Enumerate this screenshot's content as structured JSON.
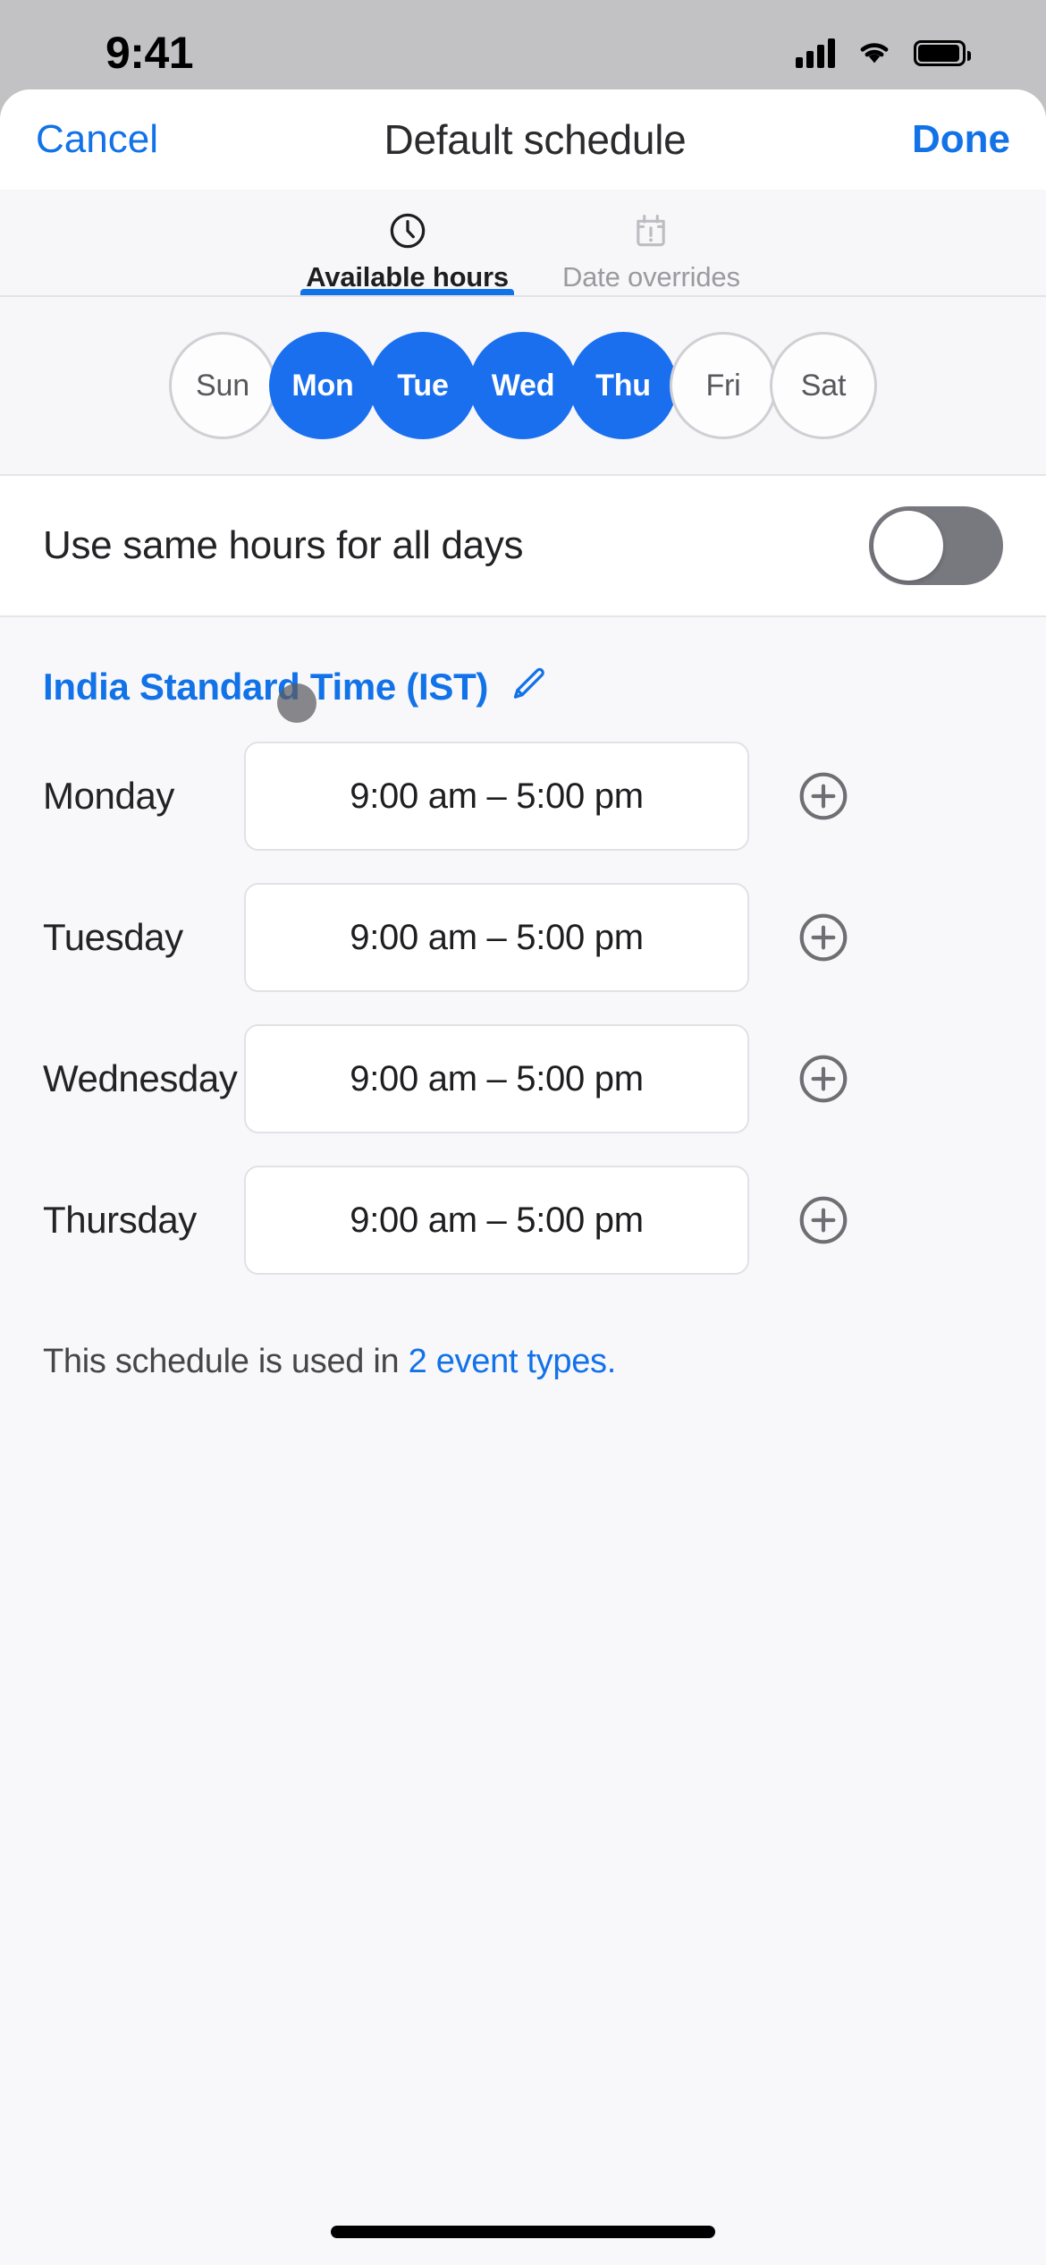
{
  "status_bar": {
    "time": "9:41",
    "cellular_icon": "signal-bars-icon",
    "wifi_icon": "wifi-icon",
    "battery_icon": "battery-full-icon"
  },
  "nav": {
    "cancel_label": "Cancel",
    "title": "Default schedule",
    "done_label": "Done"
  },
  "tabs": [
    {
      "label": "Available hours",
      "icon": "clock-icon",
      "active": true
    },
    {
      "label": "Date overrides",
      "icon": "calendar-alert-icon",
      "active": false
    }
  ],
  "day_selector": {
    "days": [
      {
        "label": "Sun",
        "selected": false
      },
      {
        "label": "Mon",
        "selected": true
      },
      {
        "label": "Tue",
        "selected": true
      },
      {
        "label": "Wed",
        "selected": true
      },
      {
        "label": "Thu",
        "selected": true
      },
      {
        "label": "Fri",
        "selected": false
      },
      {
        "label": "Sat",
        "selected": false
      }
    ]
  },
  "same_hours": {
    "label": "Use same hours for all days",
    "enabled": false
  },
  "timezone": {
    "label": "India Standard Time (IST)",
    "edit_icon": "pencil-icon"
  },
  "schedule_rows": [
    {
      "day": "Monday",
      "time_range": "9:00 am – 5:00 pm",
      "add_icon": "plus-circle-icon"
    },
    {
      "day": "Tuesday",
      "time_range": "9:00 am – 5:00 pm",
      "add_icon": "plus-circle-icon"
    },
    {
      "day": "Wednesday",
      "time_range": "9:00 am – 5:00 pm",
      "add_icon": "plus-circle-icon"
    },
    {
      "day": "Thursday",
      "time_range": "9:00 am – 5:00 pm",
      "add_icon": "plus-circle-icon"
    }
  ],
  "footer": {
    "prefix": "This schedule is used in ",
    "link": "2 event types."
  },
  "colors": {
    "accent_blue": "#1272e8",
    "selected_day_blue": "#1a6fef",
    "sheet_bg": "#f8f8fa",
    "text_primary": "#232326",
    "text_muted": "#9a9aa0"
  }
}
